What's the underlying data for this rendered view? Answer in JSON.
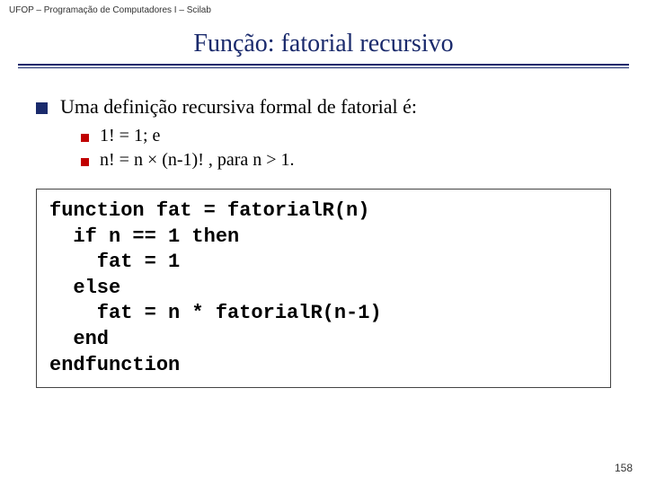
{
  "header": "UFOP – Programação de Computadores I – Scilab",
  "title": "Função: fatorial recursivo",
  "bullets": {
    "top": "Uma definição recursiva formal de fatorial é:",
    "sub1": "1! = 1; e",
    "sub2": "n! = n × (n-1)! , para n > 1."
  },
  "code": "function fat = fatorialR(n)\n  if n == 1 then\n    fat = 1\n  else\n    fat = n * fatorialR(n-1)\n  end\nendfunction",
  "pagenum": "158"
}
